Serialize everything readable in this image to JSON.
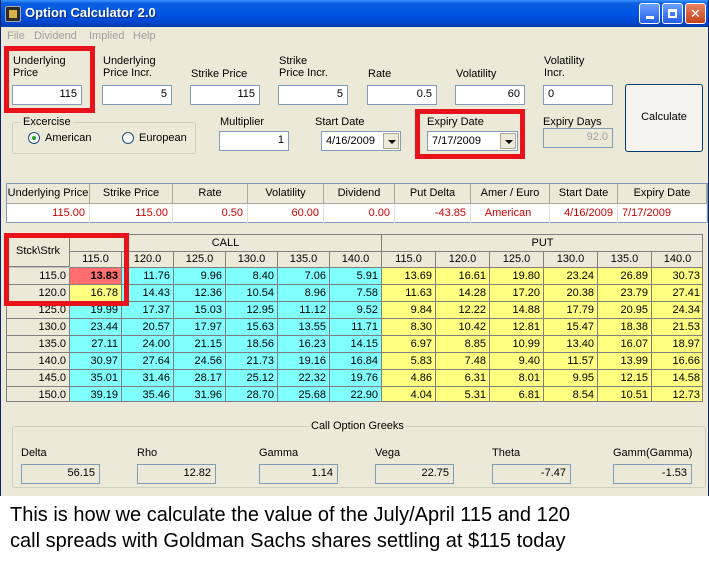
{
  "window": {
    "title": "Option Calculator 2.0"
  },
  "menu": [
    "File",
    "Dividend",
    "Implied",
    "Help"
  ],
  "inputs": {
    "underlying_price": {
      "label_1": "Underlying",
      "label_2": "Price",
      "value": "115"
    },
    "underlying_incr": {
      "label_1": "Underlying",
      "label_2": "Price Incr.",
      "value": "5"
    },
    "strike_price": {
      "label": "Strike Price",
      "value": "115"
    },
    "strike_incr": {
      "label_1": "Strike",
      "label_2": "Price Incr.",
      "value": "5"
    },
    "rate": {
      "label": "Rate",
      "value": "0.5"
    },
    "volatility": {
      "label": "Volatility",
      "value": "60"
    },
    "volatility_incr": {
      "label_1": "Volatility",
      "label_2": "Incr.",
      "value": "0"
    },
    "multiplier": {
      "label": "Multiplier",
      "value": "1"
    },
    "start_date": {
      "label": "Start Date",
      "value": "4/16/2009"
    },
    "expiry_date": {
      "label": "Expiry Date",
      "value": "7/17/2009"
    },
    "expiry_days": {
      "label": "Expiry Days",
      "value": "92.0"
    }
  },
  "exercise": {
    "legend": "Excercise",
    "options": [
      "American",
      "European"
    ],
    "selected": "American"
  },
  "calculate_button": "Calculate",
  "summary": {
    "headers": [
      "Underlying Price",
      "Strike Price",
      "Rate",
      "Volatility",
      "Dividend",
      "Put Delta",
      "Amer / Euro",
      "Start Date",
      "Expiry Date"
    ],
    "values": [
      "115.00",
      "115.00",
      "0.50",
      "60.00",
      "0.00",
      "-43.85",
      "American",
      "4/16/2009",
      "7/17/2009"
    ]
  },
  "grid": {
    "corner": "Stck\\Strk",
    "call_label": "CALL",
    "put_label": "PUT",
    "strikes": [
      "115.0",
      "120.0",
      "125.0",
      "130.0",
      "135.0",
      "140.0",
      "115.0",
      "120.0",
      "125.0",
      "130.0",
      "135.0",
      "140.0"
    ],
    "rows": [
      {
        "stock": "115.0",
        "values": [
          "13.83",
          "11.76",
          "9.96",
          "8.40",
          "7.06",
          "5.91",
          "13.69",
          "16.61",
          "19.80",
          "23.24",
          "26.89",
          "30.73"
        ]
      },
      {
        "stock": "120.0",
        "values": [
          "16.78",
          "14.43",
          "12.36",
          "10.54",
          "8.96",
          "7.58",
          "11.63",
          "14.28",
          "17.20",
          "20.38",
          "23.79",
          "27.41"
        ]
      },
      {
        "stock": "125.0",
        "values": [
          "19.99",
          "17.37",
          "15.03",
          "12.95",
          "11.12",
          "9.52",
          "9.84",
          "12.22",
          "14.88",
          "17.79",
          "20.95",
          "24.34"
        ]
      },
      {
        "stock": "130.0",
        "values": [
          "23.44",
          "20.57",
          "17.97",
          "15.63",
          "13.55",
          "11.71",
          "8.30",
          "10.42",
          "12.81",
          "15.47",
          "18.38",
          "21.53"
        ]
      },
      {
        "stock": "135.0",
        "values": [
          "27.11",
          "24.00",
          "21.15",
          "18.56",
          "16.23",
          "14.15",
          "6.97",
          "8.85",
          "10.99",
          "13.40",
          "16.07",
          "18.97"
        ]
      },
      {
        "stock": "140.0",
        "values": [
          "30.97",
          "27.64",
          "24.56",
          "21.73",
          "19.16",
          "16.84",
          "5.83",
          "7.48",
          "9.40",
          "11.57",
          "13.99",
          "16.66"
        ]
      },
      {
        "stock": "145.0",
        "values": [
          "35.01",
          "31.46",
          "28.17",
          "25.12",
          "22.32",
          "19.76",
          "4.86",
          "6.31",
          "8.01",
          "9.95",
          "12.15",
          "14.58"
        ]
      },
      {
        "stock": "150.0",
        "values": [
          "39.19",
          "35.46",
          "31.96",
          "28.70",
          "25.68",
          "22.90",
          "4.04",
          "5.31",
          "6.81",
          "8.54",
          "10.51",
          "12.73"
        ]
      }
    ]
  },
  "greeks": {
    "legend": "Call Option Greeks",
    "items": [
      {
        "label": "Delta",
        "value": "56.15"
      },
      {
        "label": "Rho",
        "value": "12.82"
      },
      {
        "label": "Gamma",
        "value": "1.14"
      },
      {
        "label": "Vega",
        "value": "22.75"
      },
      {
        "label": "Theta",
        "value": "-7.47"
      },
      {
        "label": "Gamm(Gamma)",
        "value": "-1.53"
      }
    ]
  },
  "caption": {
    "line_1": "This is how we calculate the value of the July/April 115 and 120",
    "line_2": "call spreads with Goldman Sachs shares settling at $115 today"
  },
  "colors": {
    "call_cell": "#80ffff",
    "put_cell": "#ffff80",
    "highlight": "#e8121b",
    "value_red": "#cc0000"
  }
}
